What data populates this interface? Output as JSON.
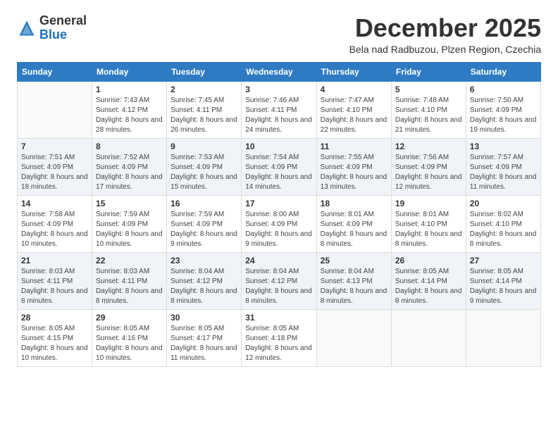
{
  "logo": {
    "general": "General",
    "blue": "Blue"
  },
  "header": {
    "month": "December 2025",
    "location": "Bela nad Radbuzou, Plzen Region, Czechia"
  },
  "weekdays": [
    "Sunday",
    "Monday",
    "Tuesday",
    "Wednesday",
    "Thursday",
    "Friday",
    "Saturday"
  ],
  "weeks": [
    [
      {
        "day": "",
        "sunrise": "",
        "sunset": "",
        "daylight": ""
      },
      {
        "day": "1",
        "sunrise": "Sunrise: 7:43 AM",
        "sunset": "Sunset: 4:12 PM",
        "daylight": "Daylight: 8 hours and 28 minutes."
      },
      {
        "day": "2",
        "sunrise": "Sunrise: 7:45 AM",
        "sunset": "Sunset: 4:11 PM",
        "daylight": "Daylight: 8 hours and 26 minutes."
      },
      {
        "day": "3",
        "sunrise": "Sunrise: 7:46 AM",
        "sunset": "Sunset: 4:11 PM",
        "daylight": "Daylight: 8 hours and 24 minutes."
      },
      {
        "day": "4",
        "sunrise": "Sunrise: 7:47 AM",
        "sunset": "Sunset: 4:10 PM",
        "daylight": "Daylight: 8 hours and 22 minutes."
      },
      {
        "day": "5",
        "sunrise": "Sunrise: 7:48 AM",
        "sunset": "Sunset: 4:10 PM",
        "daylight": "Daylight: 8 hours and 21 minutes."
      },
      {
        "day": "6",
        "sunrise": "Sunrise: 7:50 AM",
        "sunset": "Sunset: 4:09 PM",
        "daylight": "Daylight: 8 hours and 19 minutes."
      }
    ],
    [
      {
        "day": "7",
        "sunrise": "Sunrise: 7:51 AM",
        "sunset": "Sunset: 4:09 PM",
        "daylight": "Daylight: 8 hours and 18 minutes."
      },
      {
        "day": "8",
        "sunrise": "Sunrise: 7:52 AM",
        "sunset": "Sunset: 4:09 PM",
        "daylight": "Daylight: 8 hours and 17 minutes."
      },
      {
        "day": "9",
        "sunrise": "Sunrise: 7:53 AM",
        "sunset": "Sunset: 4:09 PM",
        "daylight": "Daylight: 8 hours and 15 minutes."
      },
      {
        "day": "10",
        "sunrise": "Sunrise: 7:54 AM",
        "sunset": "Sunset: 4:09 PM",
        "daylight": "Daylight: 8 hours and 14 minutes."
      },
      {
        "day": "11",
        "sunrise": "Sunrise: 7:55 AM",
        "sunset": "Sunset: 4:09 PM",
        "daylight": "Daylight: 8 hours and 13 minutes."
      },
      {
        "day": "12",
        "sunrise": "Sunrise: 7:56 AM",
        "sunset": "Sunset: 4:09 PM",
        "daylight": "Daylight: 8 hours and 12 minutes."
      },
      {
        "day": "13",
        "sunrise": "Sunrise: 7:57 AM",
        "sunset": "Sunset: 4:09 PM",
        "daylight": "Daylight: 8 hours and 11 minutes."
      }
    ],
    [
      {
        "day": "14",
        "sunrise": "Sunrise: 7:58 AM",
        "sunset": "Sunset: 4:09 PM",
        "daylight": "Daylight: 8 hours and 10 minutes."
      },
      {
        "day": "15",
        "sunrise": "Sunrise: 7:59 AM",
        "sunset": "Sunset: 4:09 PM",
        "daylight": "Daylight: 8 hours and 10 minutes."
      },
      {
        "day": "16",
        "sunrise": "Sunrise: 7:59 AM",
        "sunset": "Sunset: 4:09 PM",
        "daylight": "Daylight: 8 hours and 9 minutes."
      },
      {
        "day": "17",
        "sunrise": "Sunrise: 8:00 AM",
        "sunset": "Sunset: 4:09 PM",
        "daylight": "Daylight: 8 hours and 9 minutes."
      },
      {
        "day": "18",
        "sunrise": "Sunrise: 8:01 AM",
        "sunset": "Sunset: 4:09 PM",
        "daylight": "Daylight: 8 hours and 8 minutes."
      },
      {
        "day": "19",
        "sunrise": "Sunrise: 8:01 AM",
        "sunset": "Sunset: 4:10 PM",
        "daylight": "Daylight: 8 hours and 8 minutes."
      },
      {
        "day": "20",
        "sunrise": "Sunrise: 8:02 AM",
        "sunset": "Sunset: 4:10 PM",
        "daylight": "Daylight: 8 hours and 8 minutes."
      }
    ],
    [
      {
        "day": "21",
        "sunrise": "Sunrise: 8:03 AM",
        "sunset": "Sunset: 4:11 PM",
        "daylight": "Daylight: 8 hours and 8 minutes."
      },
      {
        "day": "22",
        "sunrise": "Sunrise: 8:03 AM",
        "sunset": "Sunset: 4:11 PM",
        "daylight": "Daylight: 8 hours and 8 minutes."
      },
      {
        "day": "23",
        "sunrise": "Sunrise: 8:04 AM",
        "sunset": "Sunset: 4:12 PM",
        "daylight": "Daylight: 8 hours and 8 minutes."
      },
      {
        "day": "24",
        "sunrise": "Sunrise: 8:04 AM",
        "sunset": "Sunset: 4:12 PM",
        "daylight": "Daylight: 8 hours and 8 minutes."
      },
      {
        "day": "25",
        "sunrise": "Sunrise: 8:04 AM",
        "sunset": "Sunset: 4:13 PM",
        "daylight": "Daylight: 8 hours and 8 minutes."
      },
      {
        "day": "26",
        "sunrise": "Sunrise: 8:05 AM",
        "sunset": "Sunset: 4:14 PM",
        "daylight": "Daylight: 8 hours and 8 minutes."
      },
      {
        "day": "27",
        "sunrise": "Sunrise: 8:05 AM",
        "sunset": "Sunset: 4:14 PM",
        "daylight": "Daylight: 8 hours and 9 minutes."
      }
    ],
    [
      {
        "day": "28",
        "sunrise": "Sunrise: 8:05 AM",
        "sunset": "Sunset: 4:15 PM",
        "daylight": "Daylight: 8 hours and 10 minutes."
      },
      {
        "day": "29",
        "sunrise": "Sunrise: 8:05 AM",
        "sunset": "Sunset: 4:16 PM",
        "daylight": "Daylight: 8 hours and 10 minutes."
      },
      {
        "day": "30",
        "sunrise": "Sunrise: 8:05 AM",
        "sunset": "Sunset: 4:17 PM",
        "daylight": "Daylight: 8 hours and 11 minutes."
      },
      {
        "day": "31",
        "sunrise": "Sunrise: 8:05 AM",
        "sunset": "Sunset: 4:18 PM",
        "daylight": "Daylight: 8 hours and 12 minutes."
      },
      {
        "day": "",
        "sunrise": "",
        "sunset": "",
        "daylight": ""
      },
      {
        "day": "",
        "sunrise": "",
        "sunset": "",
        "daylight": ""
      },
      {
        "day": "",
        "sunrise": "",
        "sunset": "",
        "daylight": ""
      }
    ]
  ]
}
